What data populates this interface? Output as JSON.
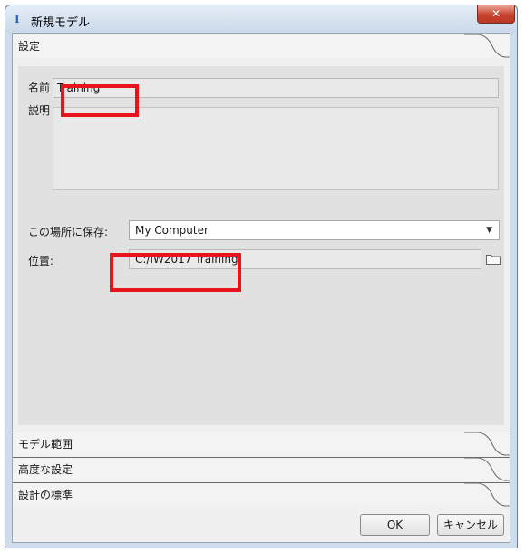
{
  "window": {
    "title": "新規モデル",
    "close_glyph": "✕",
    "app_icon": "I"
  },
  "sections": {
    "settings": {
      "label": "設定",
      "name_label": "名前",
      "name_value": "Training",
      "description_label": "説明",
      "description_value": "",
      "save_location_label": "この場所に保存",
      "save_location_value": "My Computer",
      "path_label": "位置",
      "path_value": "C:/IW2017 Training"
    },
    "model_extent": {
      "label": "モデル範囲"
    },
    "advanced": {
      "label": "高度な設定"
    },
    "design_standards": {
      "label": "設計の標準"
    }
  },
  "buttons": {
    "ok": "OK",
    "cancel": "キャンセル"
  },
  "colors": {
    "highlight": "#e8141b",
    "close_button": "#c7412c",
    "panel": "#e1e1e1"
  }
}
